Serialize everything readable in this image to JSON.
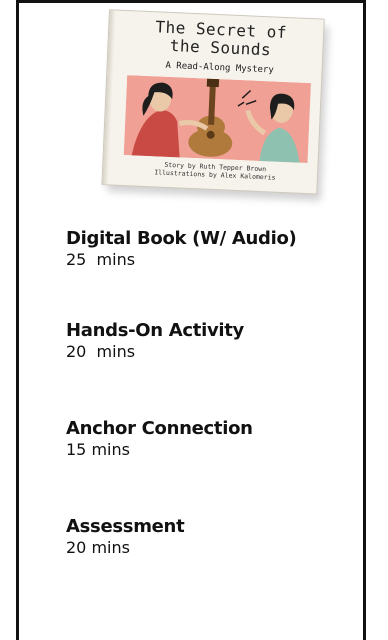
{
  "book": {
    "title_line1": "The Secret of",
    "title_line2": "the Sounds",
    "subtitle": "A Read-Along Mystery",
    "credit_story": "Story by Ruth Tepper Brown",
    "credit_illustrations": "Illustrations by Alex Kalomeris",
    "art_bg_color": "#f0a094"
  },
  "activities": [
    {
      "title": "Digital Book (W/ Audio)",
      "duration": "25  mins"
    },
    {
      "title": "Hands-On Activity",
      "duration": "20  mins"
    },
    {
      "title": "Anchor Connection",
      "duration": "15 mins"
    },
    {
      "title": "Assessment",
      "duration": "20 mins"
    }
  ]
}
